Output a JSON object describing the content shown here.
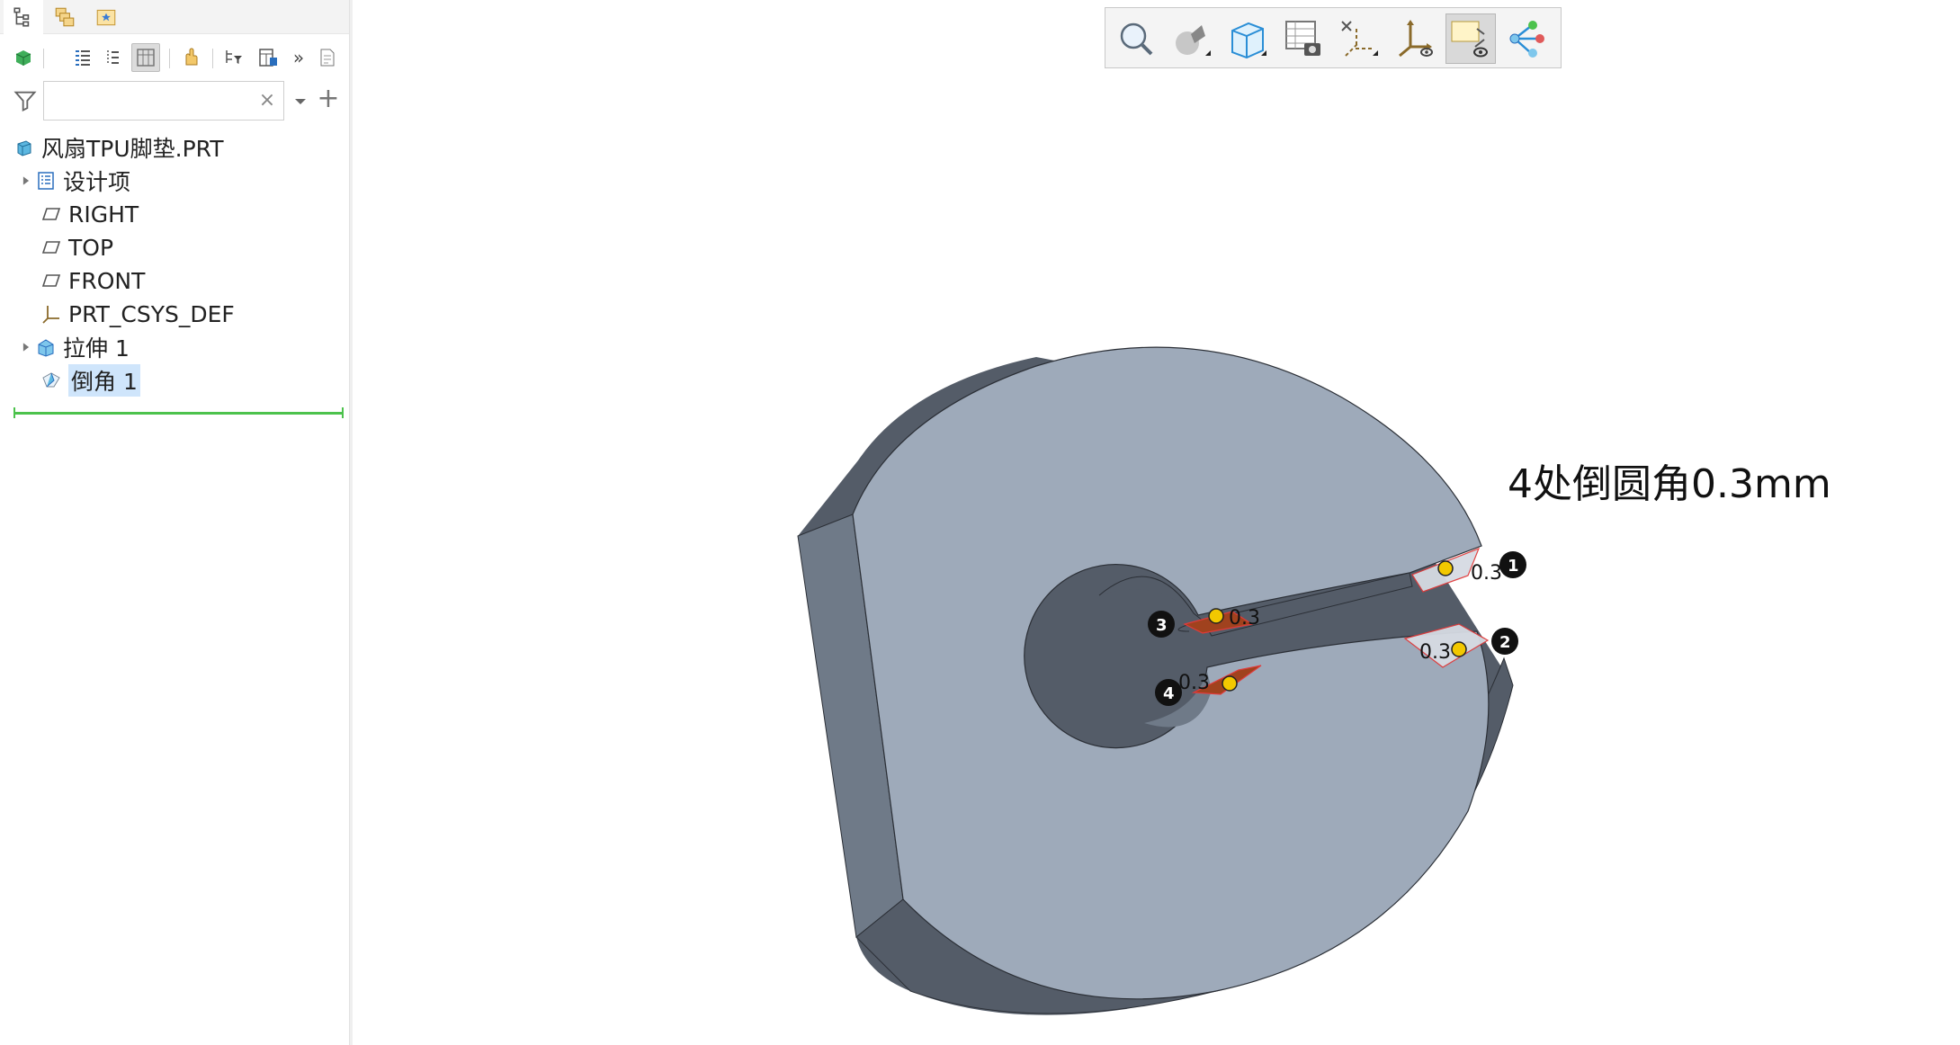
{
  "left_panel": {
    "tabs": [
      {
        "name": "model-tree-tab",
        "icon": "model-tree-icon"
      },
      {
        "name": "layers-tab",
        "icon": "layers-icon"
      },
      {
        "name": "favorites-tab",
        "icon": "star-folder-icon"
      }
    ],
    "toolbar_icons": [
      "part-icon",
      "tree-columns-icon",
      "tree-expand-icon",
      "table-icon",
      "hand-icon",
      "filter-tree-icon",
      "settings-icon",
      "more-icon",
      "document-icon"
    ],
    "overflow_label": "»",
    "filter": {
      "value": "",
      "clear_label": "×",
      "add_label": "+"
    },
    "tree": [
      {
        "label": "风扇TPU脚垫.PRT",
        "icon": "part-icon"
      },
      {
        "label": "设计项",
        "icon": "design-items-icon"
      },
      {
        "label": "RIGHT",
        "icon": "datum-plane-icon"
      },
      {
        "label": "TOP",
        "icon": "datum-plane-icon"
      },
      {
        "label": "FRONT",
        "icon": "datum-plane-icon"
      },
      {
        "label": "PRT_CSYS_DEF",
        "icon": "csys-icon"
      },
      {
        "label": "拉伸 1",
        "icon": "extrude-icon"
      },
      {
        "label": "倒角 1",
        "icon": "chamfer-icon"
      }
    ]
  },
  "graphics_toolbar": [
    "zoom-icon",
    "shading-icon",
    "view-cube-icon",
    "saved-views-icon",
    "datum-display-icon",
    "csys-display-icon",
    "annotation-display-icon",
    "spin-center-icon"
  ],
  "viewport": {
    "note": "4处倒圆角0.3mm",
    "dimensions": [
      "0.3",
      "0.3",
      "0.3",
      "0.3"
    ],
    "callouts": [
      "1",
      "2",
      "3",
      "4"
    ]
  },
  "colors": {
    "face_top": "#9eaaba",
    "face_side": "#6f7a88",
    "face_bottom": "#545c68",
    "selection": "#4cc24c",
    "highlight": "#cfe5fb",
    "handle": "#f2c800"
  }
}
